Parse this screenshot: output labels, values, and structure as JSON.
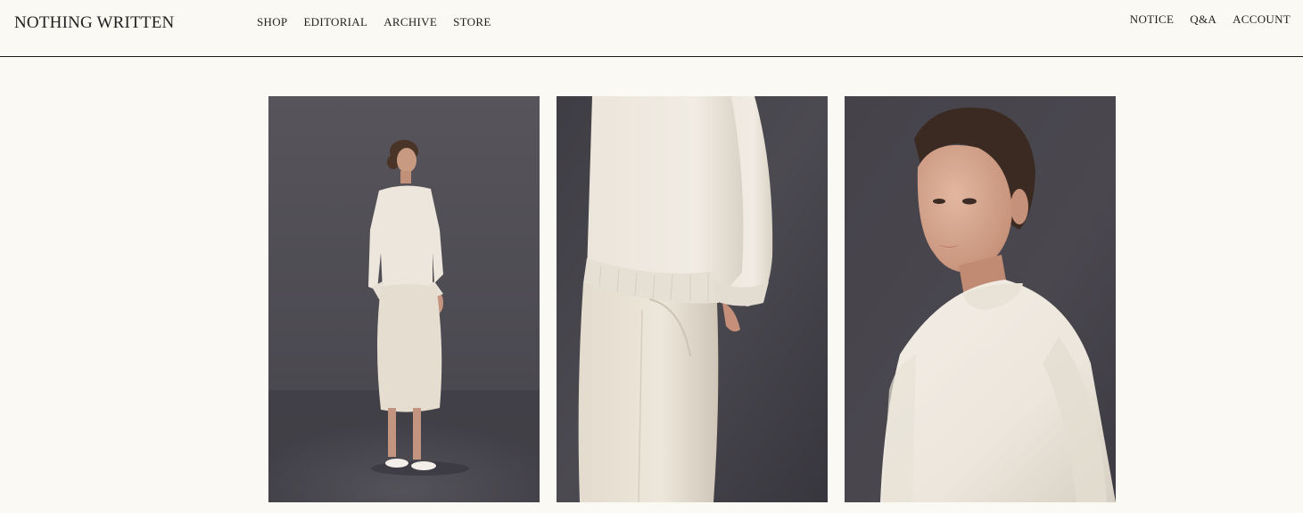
{
  "brand": {
    "name": "NOTHING WRITTEN"
  },
  "nav": {
    "main": [
      {
        "label": "SHOP"
      },
      {
        "label": "EDITORIAL"
      },
      {
        "label": "ARCHIVE"
      },
      {
        "label": "STORE"
      }
    ],
    "utility": [
      {
        "label": "NOTICE"
      },
      {
        "label": "Q&A"
      },
      {
        "label": "ACCOUNT"
      }
    ]
  },
  "gallery": {
    "images": [
      {
        "name": "full-body-look-photo"
      },
      {
        "name": "sweater-detail-photo"
      },
      {
        "name": "portrait-photo"
      }
    ]
  },
  "colors": {
    "background": "#fbf9f4",
    "backdrop": "#4a4850",
    "garment": "#ece6dc",
    "text": "#1f1f1f"
  }
}
